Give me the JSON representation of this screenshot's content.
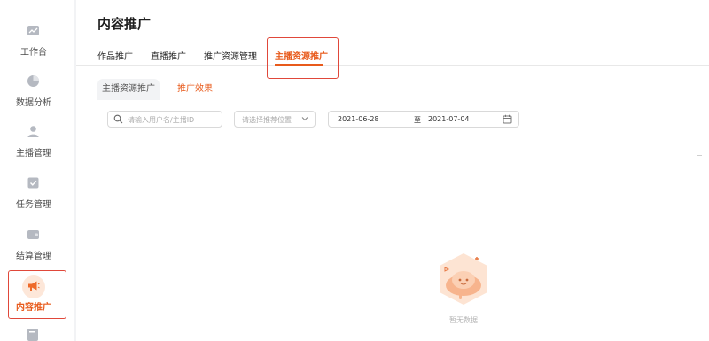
{
  "sidebar": {
    "items": [
      {
        "label": "工作台",
        "icon": "dashboard-icon"
      },
      {
        "label": "数据分析",
        "icon": "pie-chart-icon"
      },
      {
        "label": "主播管理",
        "icon": "user-icon"
      },
      {
        "label": "任务管理",
        "icon": "task-icon"
      },
      {
        "label": "结算管理",
        "icon": "wallet-icon"
      },
      {
        "label": "内容推广",
        "icon": "megaphone-icon",
        "active": true
      }
    ]
  },
  "page": {
    "title": "内容推广"
  },
  "top_tabs": [
    {
      "label": "作品推广"
    },
    {
      "label": "直播推广"
    },
    {
      "label": "推广资源管理"
    },
    {
      "label": "主播资源推广",
      "active": true
    }
  ],
  "sub_tabs": [
    {
      "label": "主播资源推广"
    },
    {
      "label": "推广效果",
      "active": true
    }
  ],
  "filters": {
    "search_placeholder": "请输入用户名/主播ID",
    "select_placeholder": "请选择推荐位置",
    "date_start": "2021-06-28",
    "date_separator": "至",
    "date_end": "2021-07-04"
  },
  "empty": {
    "text": "暂无数据"
  },
  "colors": {
    "accent": "#e85a1b",
    "highlight_border": "#e0483a"
  }
}
